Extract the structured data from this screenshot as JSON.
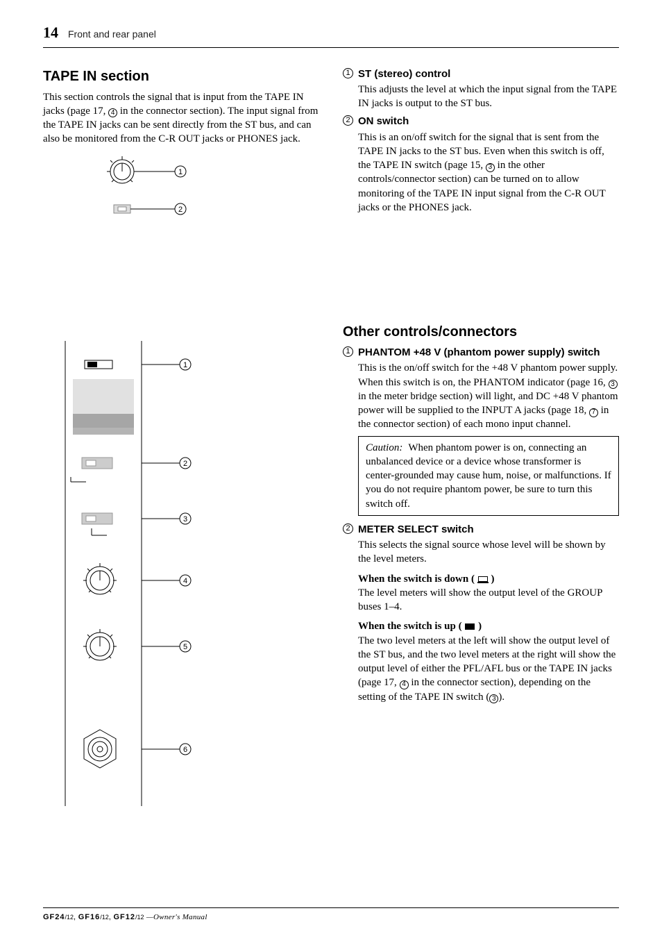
{
  "header": {
    "page_number": "14",
    "section_title": "Front and rear panel"
  },
  "left": {
    "heading": "TAPE IN section",
    "intro": "This section controls the signal that is input from the TAPE IN jacks (page 17, ④ in the connector section). The input signal from the TAPE IN jacks can be sent directly from the ST bus, and can also be monitored from the C-R OUT jacks or PHONES jack.",
    "intro_ref": "4"
  },
  "right_top": {
    "items": [
      {
        "num": "1",
        "title": "ST (stereo) control",
        "desc": "This adjusts the level at which the input signal from the TAPE IN jacks is output to the ST bus."
      },
      {
        "num": "2",
        "title": "ON switch",
        "desc": "This is an on/off switch for the signal that is sent from the TAPE IN jacks to the ST bus. Even when this switch is off, the TAPE IN switch (page 15, ③ in the other controls/connector section) can be turned on to allow monitoring of the TAPE IN input signal from the C-R OUT jacks or the PHONES jack.",
        "desc_ref": "3"
      }
    ]
  },
  "right_bottom": {
    "heading": "Other controls/connectors",
    "items": [
      {
        "num": "1",
        "title": "PHANTOM +48 V (phantom power supply) switch",
        "desc": "This is the on/off switch for the +48 V phantom power supply. When this switch is on, the PHANTOM indicator (page 16, ③ in the meter bridge section) will light, and DC +48 V phantom power will be supplied to the INPUT A jacks (page 18, ⑦ in the connector section) of each mono input channel.",
        "refs": [
          "3",
          "7"
        ],
        "caution_lead": "Caution:",
        "caution": "When phantom power is on, connecting an unbalanced device or a device whose transformer is center-grounded may cause hum, noise, or malfunctions. If you do not require phantom power, be sure to turn this switch off."
      },
      {
        "num": "2",
        "title": "METER SELECT switch",
        "desc": "This selects the signal source whose level will be shown by the level meters.",
        "sub1_head": "When the switch is down ( ▃ )",
        "sub1_body": "The level meters will show the output level of the GROUP buses 1–4.",
        "sub2_head": "When the switch is up ( ▇ )",
        "sub2_body": "The two level meters at the left will show the output level of the ST bus, and the two level meters at the right will show the output level of either the PFL/AFL bus or the TAPE IN jacks (page 17, ④ in the connector section), depending on the setting of the TAPE IN switch (③).",
        "sub2_refs": [
          "4",
          "3"
        ]
      }
    ]
  },
  "footer": {
    "models": [
      "GF24/12",
      "GF16/12",
      "GF12/12"
    ],
    "manual": "—Owner's Manual"
  },
  "icons": {
    "knob": "rotary-knob",
    "switch": "push-switch",
    "xlr": "xlr-jack"
  }
}
